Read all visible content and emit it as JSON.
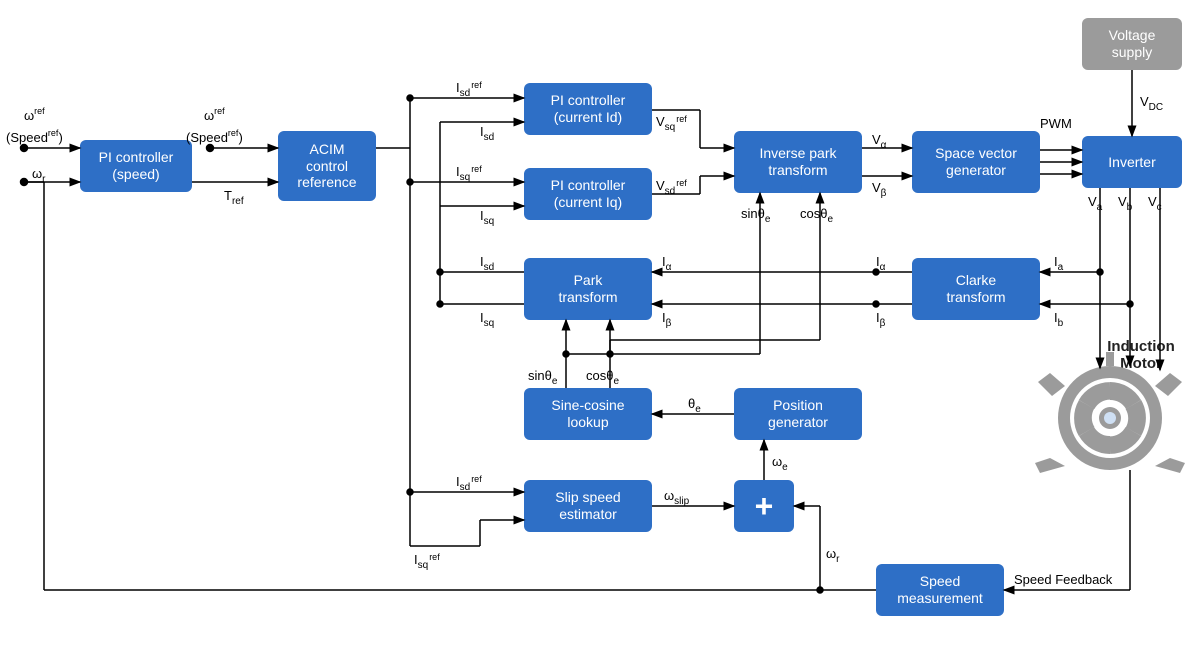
{
  "blocks": {
    "pi_speed": "PI controller\n(speed)",
    "acim": "ACIM\ncontrol\nreference",
    "pi_id": "PI controller\n(current Id)",
    "pi_iq": "PI controller\n(current Iq)",
    "park": "Park\ntransform",
    "inv_park": "Inverse park\ntransform",
    "svg_gen": "Space vector\ngenerator",
    "inverter": "Inverter",
    "voltage": "Voltage\nsupply",
    "clarke": "Clarke\ntransform",
    "sincos": "Sine-cosine\nlookup",
    "posgen": "Position\ngenerator",
    "slip": "Slip speed\nestimator",
    "speed_meas": "Speed\nmeasurement",
    "plus": "+"
  },
  "labels": {
    "motor": "Induction\nMotor",
    "w_ref": "ω",
    "ref_sup": "ref",
    "speed_ref_paren": "(Speed",
    "close_paren": ")",
    "wr": "ω",
    "sub_r": "r",
    "Tref": "T",
    "sub_ref": "ref",
    "Isd": "I",
    "Isq": "I",
    "sub_sd": "sd",
    "sub_sq": "sq",
    "Vsq": "V",
    "Vsd": "V",
    "Va": "V",
    "Vb": "V",
    "Vc": "V",
    "VDC": "V",
    "sub_DC": "DC",
    "sub_a": "a",
    "sub_b": "b",
    "sub_c": "c",
    "Valpha": "V",
    "Vbeta": "V",
    "sub_alpha": "α",
    "sub_beta": "β",
    "Ialpha": "I",
    "Ibeta": "I",
    "Ia": "I",
    "Ib": "I",
    "PWM": "PWM",
    "sin_th": "sinθ",
    "cos_th": "cosθ",
    "sub_e": "e",
    "theta": "θ",
    "omega": "ω",
    "sub_slip": "slip",
    "speed_fb": "Speed Feedback"
  }
}
